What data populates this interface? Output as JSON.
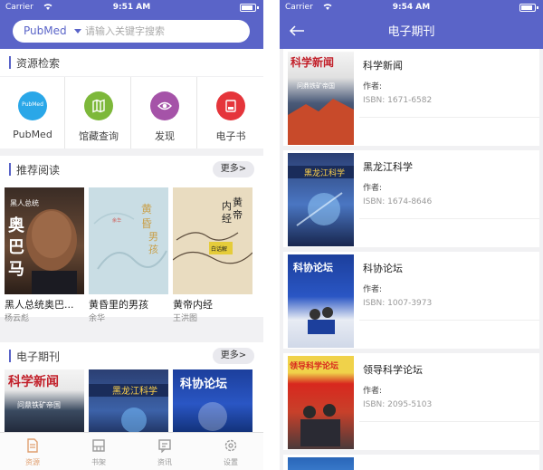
{
  "left": {
    "status": {
      "carrier": "Carrier",
      "time": "9:51 AM"
    },
    "search": {
      "scope": "PubMed",
      "placeholder": "请输入关键字搜索"
    },
    "resource_section": {
      "title": "资源检索"
    },
    "services": [
      {
        "label": "PubMed",
        "icon": "pubmed-icon",
        "color": "#2aa7e8",
        "glyph": "PubMed"
      },
      {
        "label": "馆藏查询",
        "icon": "map-icon",
        "color": "#7db83a"
      },
      {
        "label": "发现",
        "icon": "eye-icon",
        "color": "#a553a8"
      },
      {
        "label": "电子书",
        "icon": "ebook-icon",
        "color": "#e5353b"
      }
    ],
    "recommend_section": {
      "title": "推荐阅读",
      "more": "更多>"
    },
    "books": [
      {
        "title": "黑人总统奥巴...",
        "author": "杨云彪",
        "cover_lines": [
          "黑人总统",
          "奥巴马"
        ]
      },
      {
        "title": "黄昏里的男孩",
        "author": "余华",
        "cover_lines": [
          "黄昏里的男孩"
        ]
      },
      {
        "title": "黄帝内经",
        "author": "王洪图",
        "cover_lines": [
          "黄帝内经",
          "白话解"
        ]
      }
    ],
    "journal_section": {
      "title": "电子期刊",
      "more": "更多>"
    },
    "journal_thumbs": [
      {
        "masthead": "科学新闻",
        "sub": "问鼎铁矿帝国"
      },
      {
        "masthead": "黑龙江科学",
        "sub": ""
      },
      {
        "masthead": "科协论坛",
        "sub": ""
      }
    ],
    "tabs": [
      {
        "label": "资源",
        "icon": "document-icon",
        "active": true
      },
      {
        "label": "书架",
        "icon": "bookshelf-icon",
        "active": false
      },
      {
        "label": "资讯",
        "icon": "news-icon",
        "active": false
      },
      {
        "label": "设置",
        "icon": "gear-icon",
        "active": false
      }
    ]
  },
  "right": {
    "status": {
      "carrier": "Carrier",
      "time": "9:54 AM"
    },
    "title": "电子期刊",
    "journals": [
      {
        "name": "科学新闻",
        "author_label": "作者:",
        "issn": "ISBN: 1671-6582",
        "masthead": "科学新闻",
        "sub": "问鼎铁矿帝国",
        "accent": "#c2202a"
      },
      {
        "name": "黑龙江科学",
        "author_label": "作者:",
        "issn": "ISBN: 1674-8646",
        "masthead": "黑龙江科学",
        "sub": "",
        "accent": "#1a3a7a"
      },
      {
        "name": "科协论坛",
        "author_label": "作者:",
        "issn": "ISBN: 1007-3973",
        "masthead": "科协论坛",
        "sub": "",
        "accent": "#1c3f9c"
      },
      {
        "name": "领导科学论坛",
        "author_label": "作者:",
        "issn": "ISBN: 2095-5103",
        "masthead": "领导科学论坛",
        "sub": "",
        "accent": "#d8281e"
      }
    ]
  },
  "colors": {
    "brand": "#5a64c8",
    "tab_active": "#e0a070"
  }
}
